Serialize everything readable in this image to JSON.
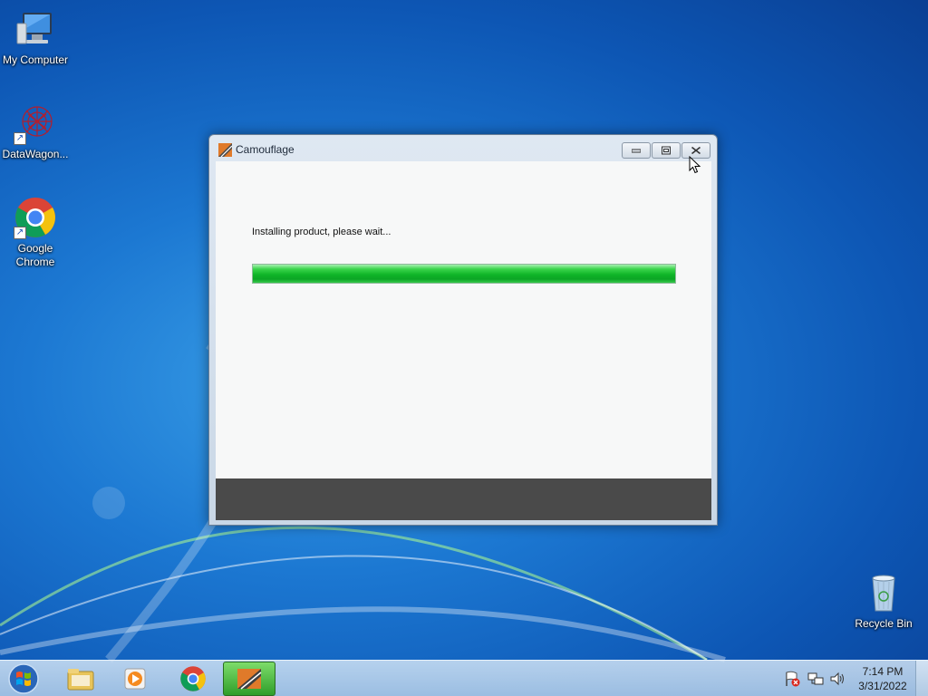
{
  "desktop": {
    "icons": [
      {
        "label": "My Computer",
        "icon": "computer-icon"
      },
      {
        "label": "DataWagon...",
        "icon": "datawagon-icon"
      },
      {
        "label": "Google Chrome",
        "icon": "chrome-icon"
      },
      {
        "label": "Recycle Bin",
        "icon": "recycle-bin-icon"
      }
    ]
  },
  "window": {
    "title": "Camouflage",
    "status_text": "Installing product, please wait...",
    "progress_percent": 100
  },
  "taskbar": {
    "pinned": [
      {
        "icon": "file-explorer-icon"
      },
      {
        "icon": "media-player-icon"
      },
      {
        "icon": "chrome-icon"
      },
      {
        "icon": "camouflage-icon",
        "active": true
      }
    ],
    "tray": [
      "action-center-flag-icon",
      "network-icon",
      "volume-icon"
    ],
    "clock_time": "7:14 PM",
    "clock_date": "3/31/2022"
  },
  "colors": {
    "progress_green": "#0fb528",
    "footer_bar": "#4a4a4a",
    "desktop_blue": "#1c78d2"
  }
}
